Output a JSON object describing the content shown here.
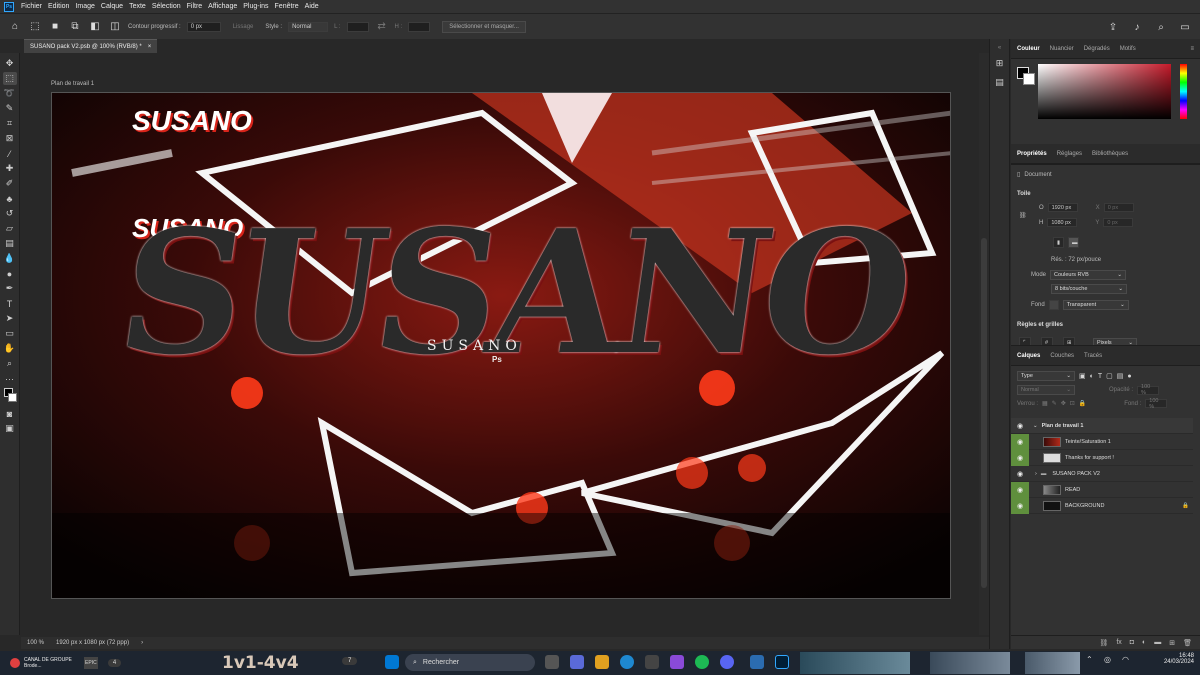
{
  "app": {
    "menu": [
      "Fichier",
      "Edition",
      "Image",
      "Calque",
      "Texte",
      "Sélection",
      "Filtre",
      "Affichage",
      "Plug-ins",
      "Fenêtre",
      "Aide"
    ]
  },
  "options": {
    "contour_label": "Contour progressif :",
    "contour_value": "0 px",
    "lissage": "Lissage",
    "style_label": "Style :",
    "style_value": "Normal",
    "l_label": "L :",
    "h_label": "H :",
    "select_mask": "Sélectionner et masquer..."
  },
  "document": {
    "tab_title": "SUSANO pack V2.psb @ 100% (RVB/8) *",
    "artboard_label": "Plan de travail 1",
    "zoom": "100 %",
    "doc_info": "1920 px x 1080 px (72 ppp)"
  },
  "artwork": {
    "logo_top": "SUSANO",
    "logo_mid": "SUSANO",
    "big_text": "SUSANO",
    "center_text": "SUSANO",
    "center_ps": "Ps"
  },
  "color_panel": {
    "tabs": [
      "Couleur",
      "Nuancier",
      "Dégradés",
      "Motifs"
    ]
  },
  "properties": {
    "tabs": [
      "Propriétés",
      "Réglages",
      "Bibliothèques"
    ],
    "doc_label": "Document",
    "toile": "Toile",
    "w_label": "O",
    "w_value": "1920 px",
    "h_label": "H",
    "h_value": "1080 px",
    "x_label": "X",
    "x_value": "0 px",
    "y_label": "Y",
    "y_value": "0 px",
    "resolution": "Rés. : 72 px/pouce",
    "mode_label": "Mode",
    "mode_value": "Couleurs RVB",
    "depth_value": "8 bits/couche",
    "fond_label": "Fond",
    "fond_value": "Transparent",
    "grids": "Règles et grilles",
    "units_value": "Pixels"
  },
  "layers": {
    "tabs": [
      "Calques",
      "Couches",
      "Tracés"
    ],
    "filter_value": "Type",
    "blend": "Normal",
    "opacity_label": "Opacité :",
    "opacity_value": "100 %",
    "lock_label": "Verrou :",
    "fill_label": "Fond :",
    "fill_value": "100 %",
    "artboard": "Plan de travail 1",
    "items": [
      {
        "name": "Teinte/Saturation 1"
      },
      {
        "name": "Thanks for support !"
      },
      {
        "name": "SUSANO PACK V2"
      },
      {
        "name": "READ"
      },
      {
        "name": "BACKGROUND"
      }
    ]
  },
  "taskbar": {
    "widget_title": "CANAL DE GROUPE",
    "widget_sub": "Brode...",
    "badge1": "4",
    "score": "1v1-4v4",
    "badge2": "7",
    "search_placeholder": "Rechercher",
    "time": "16:48",
    "date": "24/03/2024"
  }
}
